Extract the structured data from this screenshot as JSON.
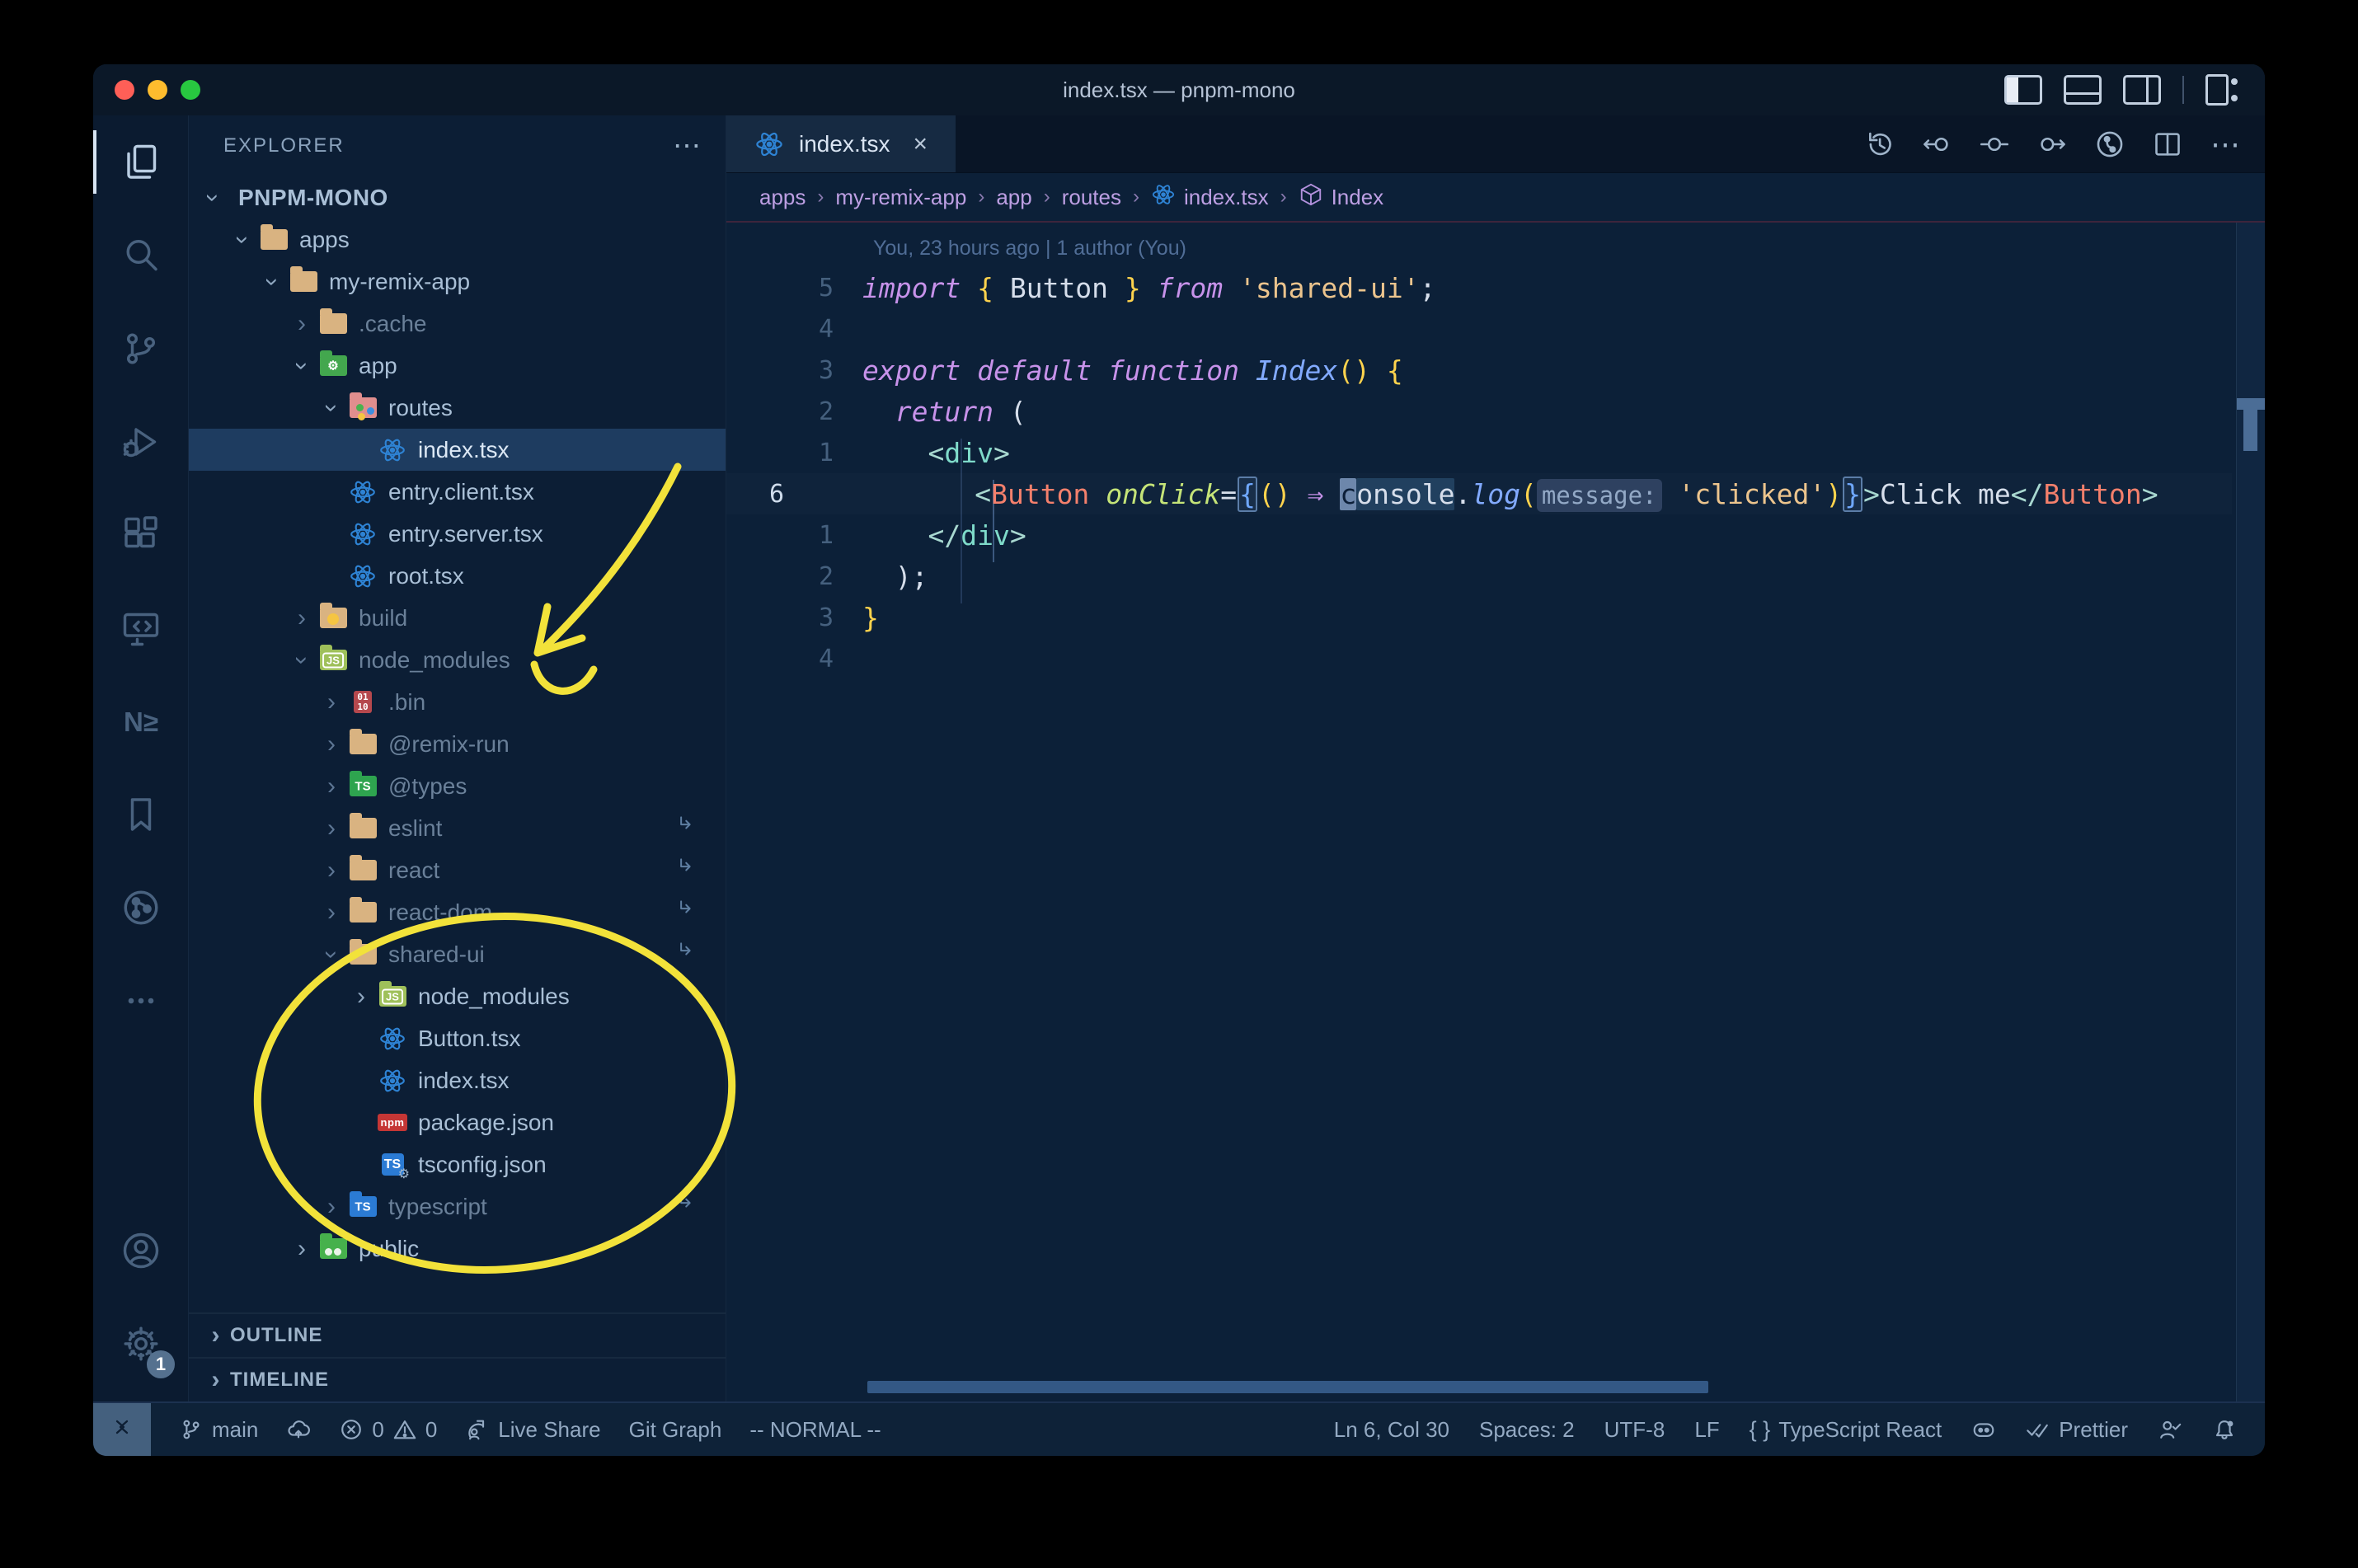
{
  "colors": {
    "editor_bg": "#0c2038",
    "sidebar_bg": "#0c1e35",
    "activity_bg": "#0b1b30",
    "title_bg": "#0b1828",
    "tabstrip_bg": "#091526",
    "tab_active_bg": "#162a42",
    "statusbar_bg": "#0e2238",
    "sel_row": "#1e3c60",
    "accent_yellow": "#f2e23a",
    "crumb": "#bd9fe3",
    "react_blue": "#2e83d4"
  },
  "window": {
    "title": "index.tsx — pnpm-mono"
  },
  "activity_bar": {
    "items": [
      {
        "name": "explorer",
        "active": true
      },
      {
        "name": "search"
      },
      {
        "name": "source-control"
      },
      {
        "name": "run-debug"
      },
      {
        "name": "extensions"
      },
      {
        "name": "remote-explorer"
      },
      {
        "name": "nx-console"
      },
      {
        "name": "bookmarks"
      },
      {
        "name": "gitlens"
      },
      {
        "name": "more"
      }
    ],
    "bottom": [
      {
        "name": "accounts"
      },
      {
        "name": "settings",
        "badge": "1"
      }
    ]
  },
  "sidebar": {
    "header": "EXPLORER",
    "header_more_icon": "⋯",
    "tree": [
      {
        "label": "PNPM-MONO",
        "level": 0,
        "chevron": "down",
        "root": true
      },
      {
        "label": "apps",
        "level": 1,
        "chevron": "down",
        "icon": "folder-tan"
      },
      {
        "label": "my-remix-app",
        "level": 2,
        "chevron": "down",
        "icon": "folder-tan"
      },
      {
        "label": ".cache",
        "level": 3,
        "chevron": "right",
        "icon": "folder-tan",
        "dim": true
      },
      {
        "label": "app",
        "level": 3,
        "chevron": "down",
        "icon": "folder-app"
      },
      {
        "label": "routes",
        "level": 4,
        "chevron": "down",
        "icon": "folder-routes"
      },
      {
        "label": "index.tsx",
        "level": 5,
        "icon": "file-react",
        "selected": true
      },
      {
        "label": "entry.client.tsx",
        "level": 4,
        "icon": "file-react"
      },
      {
        "label": "entry.server.tsx",
        "level": 4,
        "icon": "file-react"
      },
      {
        "label": "root.tsx",
        "level": 4,
        "icon": "file-react"
      },
      {
        "label": "build",
        "level": 3,
        "chevron": "right",
        "icon": "folder-build",
        "dim": true
      },
      {
        "label": "node_modules",
        "level": 3,
        "chevron": "down",
        "icon": "folder-nm",
        "dim": true
      },
      {
        "label": ".bin",
        "level": 4,
        "chevron": "right",
        "icon": "file-bin",
        "dim": true
      },
      {
        "label": "@remix-run",
        "level": 4,
        "chevron": "right",
        "icon": "folder-tan",
        "dim": true
      },
      {
        "label": "@types",
        "level": 4,
        "chevron": "right",
        "icon": "folder-types",
        "dim": true
      },
      {
        "label": "eslint",
        "level": 4,
        "chevron": "right",
        "icon": "folder-tan",
        "dim": true,
        "symlink": true
      },
      {
        "label": "react",
        "level": 4,
        "chevron": "right",
        "icon": "folder-tan",
        "dim": true,
        "symlink": true
      },
      {
        "label": "react-dom",
        "level": 4,
        "chevron": "right",
        "icon": "folder-tan",
        "dim": true,
        "symlink": true
      },
      {
        "label": "shared-ui",
        "level": 4,
        "chevron": "down",
        "icon": "folder-tan",
        "dim": true,
        "symlink": true
      },
      {
        "label": "node_modules",
        "level": 5,
        "chevron": "right",
        "icon": "folder-nm"
      },
      {
        "label": "Button.tsx",
        "level": 5,
        "icon": "file-react"
      },
      {
        "label": "index.tsx",
        "level": 5,
        "icon": "file-react"
      },
      {
        "label": "package.json",
        "level": 5,
        "icon": "file-npm"
      },
      {
        "label": "tsconfig.json",
        "level": 5,
        "icon": "file-tsconfig"
      },
      {
        "label": "typescript",
        "level": 4,
        "chevron": "right",
        "icon": "folder-typescript",
        "dim": true,
        "symlink": true
      },
      {
        "label": "public",
        "level": 3,
        "chevron": "right",
        "icon": "folder-public"
      }
    ],
    "sections": [
      {
        "label": "OUTLINE"
      },
      {
        "label": "TIMELINE"
      }
    ]
  },
  "editor": {
    "tab": {
      "label": "index.tsx",
      "icon": "react",
      "close": "×"
    },
    "actions": [
      "history",
      "prev-change",
      "changes",
      "next-change",
      "commit-graph",
      "split-editor"
    ],
    "actions_more_icon": "⋯",
    "breadcrumbs": [
      {
        "label": "apps"
      },
      {
        "label": "my-remix-app"
      },
      {
        "label": "app"
      },
      {
        "label": "routes"
      },
      {
        "label": "index.tsx",
        "icon": "react"
      },
      {
        "label": "Index",
        "icon": "symbol-cube"
      }
    ],
    "blame": "You, 23 hours ago | 1 author (You)",
    "lines": [
      {
        "type": "blame"
      },
      {
        "num": "5",
        "tokens": [
          [
            "kw",
            "import"
          ],
          [
            "pl",
            " "
          ],
          [
            "gold",
            "{"
          ],
          [
            "pl",
            " Button "
          ],
          [
            "gold",
            "}"
          ],
          [
            "pl",
            " "
          ],
          [
            "kw",
            "from"
          ],
          [
            "pl",
            " "
          ],
          [
            "str",
            "'shared-ui'"
          ],
          [
            "pl",
            ";"
          ]
        ]
      },
      {
        "num": "4",
        "tokens": []
      },
      {
        "num": "3",
        "tokens": [
          [
            "kw",
            "export"
          ],
          [
            "pl",
            " "
          ],
          [
            "kw",
            "default"
          ],
          [
            "pl",
            " "
          ],
          [
            "kw",
            "function"
          ],
          [
            "pl",
            " "
          ],
          [
            "fn",
            "Index"
          ],
          [
            "gold",
            "()"
          ],
          [
            "pl",
            " "
          ],
          [
            "gold",
            "{"
          ]
        ]
      },
      {
        "num": "2",
        "tokens": [
          [
            "pl",
            "  "
          ],
          [
            "kw",
            "return"
          ],
          [
            "pl",
            " ("
          ]
        ]
      },
      {
        "num": "1",
        "tokens": [
          [
            "pl",
            "    "
          ],
          [
            "tagb",
            "<"
          ],
          [
            "tag",
            "div"
          ],
          [
            "tagb",
            ">"
          ]
        ]
      },
      {
        "num": "6",
        "current": true,
        "tokens": [
          [
            "pl",
            "      "
          ],
          [
            "tagb",
            "<"
          ],
          [
            "comp",
            "Button"
          ],
          [
            "pl",
            " "
          ],
          [
            "attr",
            "onClick"
          ],
          [
            "pl",
            "="
          ],
          [
            "bluebox",
            "{"
          ],
          [
            "gold",
            "()"
          ],
          [
            "pl",
            " "
          ],
          [
            "arrow",
            "⇒"
          ],
          [
            "pl",
            " "
          ],
          [
            "cursor",
            "c"
          ],
          [
            "hl",
            "onsole"
          ],
          [
            "pl",
            "."
          ],
          [
            "fn",
            "log"
          ],
          [
            "gold",
            "("
          ],
          [
            "inlay",
            "message:"
          ],
          [
            "pl",
            " "
          ],
          [
            "str",
            "'clicked'"
          ],
          [
            "gold",
            ")"
          ],
          [
            "bluebox",
            "}"
          ],
          [
            "tagb",
            ">"
          ],
          [
            "pl",
            "Click me"
          ],
          [
            "tagb",
            "</"
          ],
          [
            "comp",
            "Button"
          ],
          [
            "tagb",
            ">"
          ]
        ]
      },
      {
        "num": "1",
        "tokens": [
          [
            "pl",
            "    "
          ],
          [
            "tagb",
            "</"
          ],
          [
            "tag",
            "div"
          ],
          [
            "tagb",
            ">"
          ]
        ]
      },
      {
        "num": "2",
        "tokens": [
          [
            "pl",
            "  );"
          ]
        ]
      },
      {
        "num": "3",
        "tokens": [
          [
            "gold",
            "}"
          ]
        ]
      },
      {
        "num": "4",
        "tokens": []
      }
    ]
  },
  "status_bar": {
    "left": [
      {
        "name": "remote-indicator",
        "remote": true,
        "parts": [
          [
            "icon",
            "remote-status"
          ]
        ]
      },
      {
        "name": "git-branch",
        "parts": [
          [
            "icon",
            "branch"
          ],
          [
            "text",
            "main"
          ]
        ]
      },
      {
        "name": "publish",
        "parts": [
          [
            "icon",
            "cloud"
          ]
        ]
      },
      {
        "name": "problems",
        "parts": [
          [
            "icon",
            "error"
          ],
          [
            "text",
            "0"
          ],
          [
            "icon",
            "warning"
          ],
          [
            "text",
            "0"
          ]
        ]
      },
      {
        "name": "live-share",
        "parts": [
          [
            "icon",
            "liveshare"
          ],
          [
            "text",
            "Live Share"
          ]
        ]
      },
      {
        "name": "git-graph",
        "parts": [
          [
            "text",
            "Git Graph"
          ]
        ]
      },
      {
        "name": "vim-mode",
        "parts": [
          [
            "text",
            "-- NORMAL --"
          ]
        ]
      }
    ],
    "right": [
      {
        "name": "cursor-position",
        "parts": [
          [
            "text",
            "Ln 6, Col 30"
          ]
        ]
      },
      {
        "name": "indentation",
        "parts": [
          [
            "text",
            "Spaces: 2"
          ]
        ]
      },
      {
        "name": "encoding",
        "parts": [
          [
            "text",
            "UTF-8"
          ]
        ]
      },
      {
        "name": "eol",
        "parts": [
          [
            "text",
            "LF"
          ]
        ]
      },
      {
        "name": "language-mode",
        "parts": [
          [
            "glyph",
            "{ }"
          ],
          [
            "text",
            "TypeScript React"
          ]
        ]
      },
      {
        "name": "copilot",
        "parts": [
          [
            "icon",
            "copilot"
          ]
        ]
      },
      {
        "name": "formatter-prettier",
        "parts": [
          [
            "icon",
            "checks"
          ],
          [
            "text",
            "Prettier"
          ]
        ]
      },
      {
        "name": "feedback",
        "parts": [
          [
            "icon",
            "feedback"
          ]
        ]
      },
      {
        "name": "notifications",
        "parts": [
          [
            "icon",
            "bell"
          ]
        ]
      }
    ]
  },
  "annotations": {
    "color": "#f2e23a",
    "arrow_target": "node_modules",
    "circle_target": "shared-ui package contents"
  }
}
